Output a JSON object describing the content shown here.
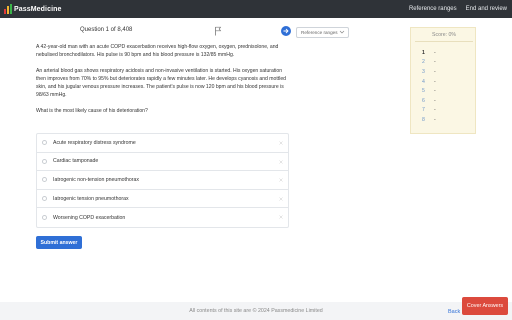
{
  "header": {
    "logo_text": "PassMedicine",
    "logo_bar_colors": [
      "#e23b3b",
      "#f2b632",
      "#3bb44a"
    ],
    "nav": [
      "Reference ranges",
      "End and review"
    ]
  },
  "question_bar": {
    "counter": "Question 1 of 8,408",
    "flag_icon": "flag-icon",
    "next_icon": "arrow-right-icon",
    "reference_select": "Reference ranges"
  },
  "question": {
    "paragraphs": [
      "A 42-year-old man with an acute COPD exacerbation receives high-flow oxygen, oxygen, prednisolone, and nebulised bronchodilators. His pulse is 90 bpm and his blood pressure is 132/85 mmHg.",
      "An arterial blood gas shows respiratory acidosis and non-invasive ventilation is started. His oxygen saturation then improves from 70% to 95% but deteriorates rapidly a few minutes later. He develops cyanosis and mottled skin, and his jugular venous pressure increases. The patient's pulse is now 120 bpm and his blood pressure is 98/63 mmHg.",
      "What is the most likely cause of his deterioration?"
    ],
    "options": [
      "Acute respiratory distress syndrome",
      "Cardiac tamponade",
      "Iatrogenic non-tension pneumothorax",
      "Iatrogenic tension pneumothorax",
      "Worsening COPD exacerbation"
    ],
    "submit_label": "Submit answer"
  },
  "score": {
    "title": "Score: 0%",
    "rows": [
      {
        "num": "1",
        "val": "-"
      },
      {
        "num": "2",
        "val": "-"
      },
      {
        "num": "3",
        "val": "-"
      },
      {
        "num": "4",
        "val": "-"
      },
      {
        "num": "5",
        "val": "-"
      },
      {
        "num": "6",
        "val": "-"
      },
      {
        "num": "7",
        "val": "-"
      },
      {
        "num": "8",
        "val": "-"
      }
    ]
  },
  "footer": {
    "text": "All contents of this site are © 2024 Passmedicine Limited",
    "back_label": "Back",
    "cover_label": "Cover Answers"
  },
  "colors": {
    "topbar": "#2f3338",
    "accent_blue": "#2f6fd6",
    "score_bg": "#fbf7e4",
    "cover_red": "#dc4a3d"
  }
}
